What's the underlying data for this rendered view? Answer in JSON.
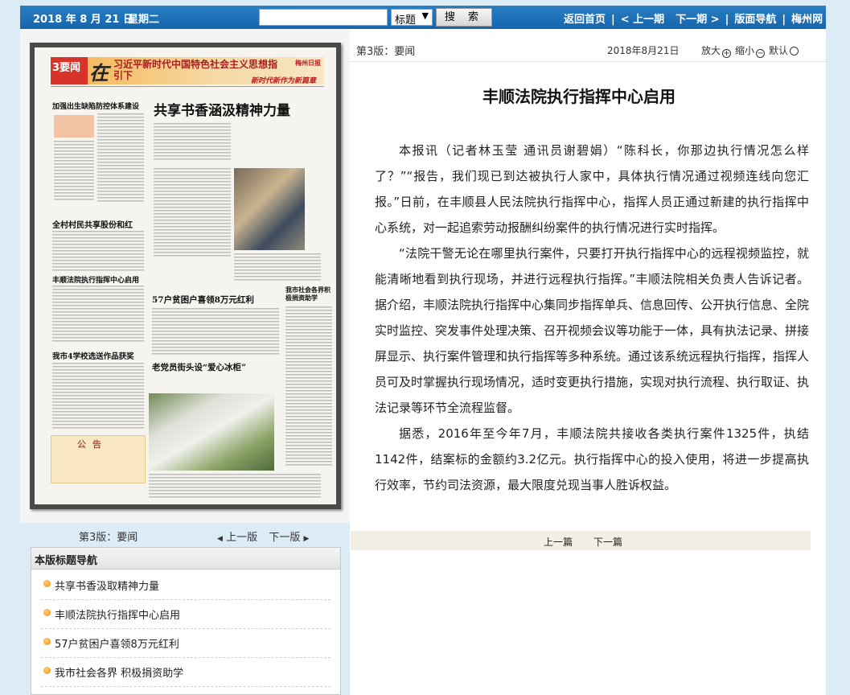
{
  "topbar": {
    "date": "2018 年 8 月 21 日",
    "weekday": "星期二",
    "search_placeholder": "",
    "search_type": "标题",
    "search_button": "搜 索",
    "nav": [
      "返回首页",
      "< 上一期",
      "下一期 >",
      "版面导航",
      "梅州网"
    ]
  },
  "newspaper_thumbnail": {
    "section_badge": "3要闻",
    "slogan_char": "在",
    "slogan": "习近平新时代中国特色社会主义思想指引下",
    "masthead": "梅州日报",
    "subhead": "新时代新作为新篇章",
    "headline_main": "共享书香涵汲精神力量",
    "headline_2": "全村村民共享股份和红",
    "headline_3": "丰顺法院执行指挥中心启用",
    "headline_4": "我市4学校选送作品获奖",
    "headline_5": "57户贫困户喜领8万元红利",
    "headline_6": "老党员街头设“爱心冰柜”",
    "headline_7": "我市社会各界积极捐资助学",
    "headline_8": "加强出生缺陷防控体系建设",
    "notice": "公告"
  },
  "page_info": {
    "page_label": "第3版：要闻",
    "prev_page": "上一版",
    "next_page": "下一版"
  },
  "headline_nav": {
    "title": "本版标题导航",
    "items": [
      "共享书香汲取精神力量",
      "丰顺法院执行指挥中心启用",
      "57户贫困户喜领8万元红利",
      "我市社会各界 积极捐资助学"
    ]
  },
  "article": {
    "page_label": "第3版：要闻",
    "date": "2018年8月21日",
    "zoom_in": "放大",
    "zoom_out": "缩小",
    "zoom_default": "默认",
    "title": "丰顺法院执行指挥中心启用",
    "paragraphs": [
      "本报讯（记者林玉莹 通讯员谢碧娟）“陈科长，你那边执行情况怎么样了？”“报告，我们现已到达被执行人家中，具体执行情况通过视频连线向您汇报。”日前，在丰顺县人民法院执行指挥中心，指挥人员正通过新建的执行指挥中心系统，对一起追索劳动报酬纠纷案件的执行情况进行实时指挥。",
      "“法院干警无论在哪里执行案件，只要打开执行指挥中心的远程视频监控，就能清晰地看到执行现场，并进行远程执行指挥。”丰顺法院相关负责人告诉记者。据介绍，丰顺法院执行指挥中心集同步指挥单兵、信息回传、公开执行信息、全院实时监控、突发事件处理决策、召开视频会议等功能于一体，具有执法记录、拼接屏显示、执行案件管理和执行指挥等多种系统。通过该系统远程执行指挥，指挥人员可及时掌握执行现场情况，适时变更执行措施，实现对执行流程、执行取证、执法记录等环节全流程监督。",
      "据悉，2016年至今年7月，丰顺法院共接收各类执行案件1325件，执结1142件，结案标的金额约3.2亿元。执行指挥中心的投入使用，将进一步提高执行效率，节约司法资源，最大限度兑现当事人胜诉权益。"
    ],
    "prev_article": "上一篇",
    "next_article": "下一篇"
  }
}
